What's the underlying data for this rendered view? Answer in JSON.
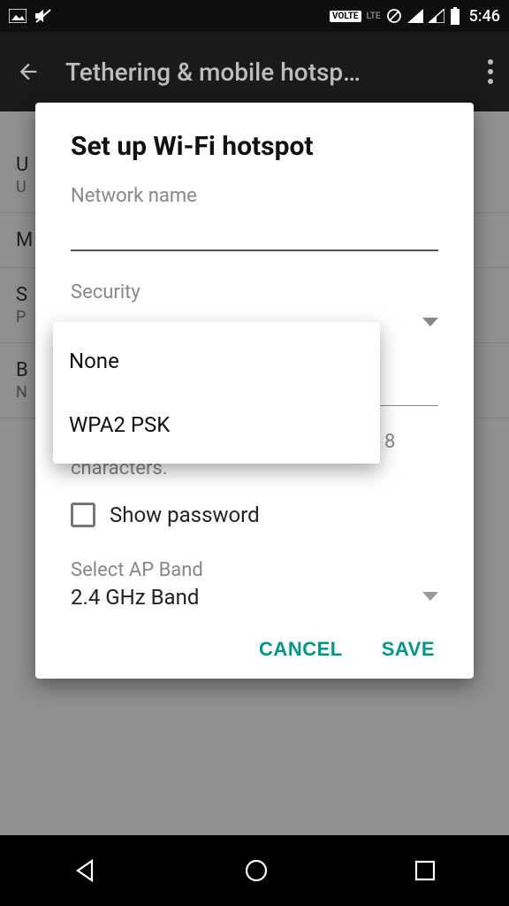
{
  "status": {
    "volte": "VOLTE",
    "lte": "LTE",
    "time": "5:46"
  },
  "header": {
    "title": "Tethering & mobile hotsp…"
  },
  "background_items": [
    {
      "title": "U",
      "sub": "U"
    },
    {
      "title": "M",
      "sub": ""
    },
    {
      "title": "S",
      "sub": "P"
    },
    {
      "title": "B",
      "sub": "N"
    }
  ],
  "dialog": {
    "title": "Set up Wi-Fi hotspot",
    "network_name_label": "Network name",
    "network_name_value": "",
    "security_label": "Security",
    "security_value": "",
    "password_helper": "The password must contain at least 8 characters.",
    "show_password_label": "Show password",
    "ap_band_label": "Select AP Band",
    "ap_band_value": "2.4 GHz Band",
    "cancel": "CANCEL",
    "save": "SAVE"
  },
  "security_options": [
    "None",
    "WPA2 PSK"
  ]
}
